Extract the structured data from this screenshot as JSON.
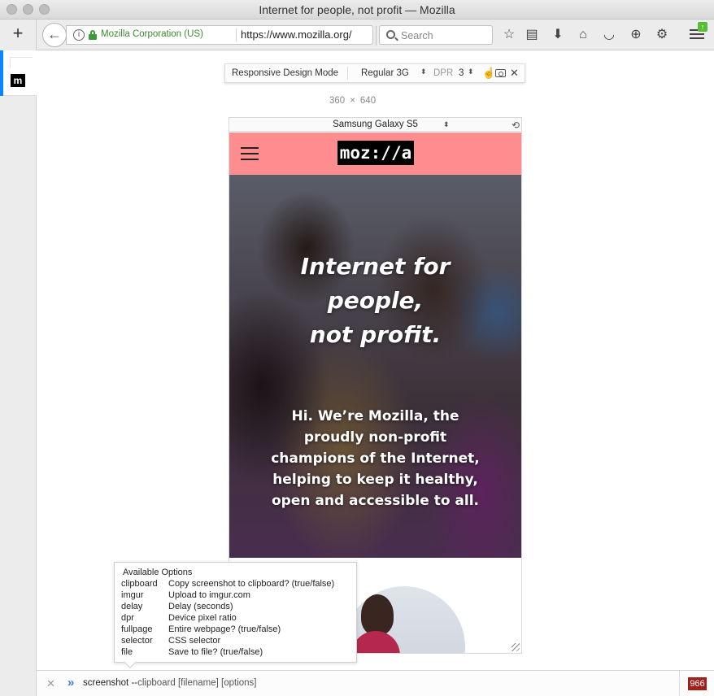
{
  "window": {
    "title": "Internet for people, not profit — Mozilla"
  },
  "sidebar": {
    "new_tab_label": "+"
  },
  "toolbar": {
    "identity": "Mozilla Corporation (US)",
    "url": "https://www.mozilla.org/",
    "search_placeholder": "Search"
  },
  "rdm": {
    "label": "Responsive Design Mode",
    "network": "Regular 3G",
    "dpr_label": "DPR",
    "dpr_value": "3",
    "width": "360",
    "times": "×",
    "height": "640",
    "device": "Samsung Galaxy S5"
  },
  "page": {
    "logo": "moz://a",
    "hero_lines": [
      "Internet for",
      "people,",
      "not profit."
    ],
    "hero_sub": "Hi. We’re Mozilla, the proudly non-profit champions of the Internet, helping to keep it healthy, open and accessible to all."
  },
  "options": {
    "title": "Available Options",
    "items": [
      {
        "name": "clipboard",
        "desc": "Copy screenshot to clipboard? (true/false)"
      },
      {
        "name": "imgur",
        "desc": "Upload to imgur.com"
      },
      {
        "name": "delay",
        "desc": "Delay (seconds)"
      },
      {
        "name": "dpr",
        "desc": "Device pixel ratio"
      },
      {
        "name": "fullpage",
        "desc": "Entire webpage? (true/false)"
      },
      {
        "name": "selector",
        "desc": "CSS selector"
      },
      {
        "name": "file",
        "desc": "Save to file? (true/false)"
      }
    ]
  },
  "command": {
    "input": "screenshot --",
    "hint": "clipboard [filename] [options]",
    "count": "966"
  }
}
